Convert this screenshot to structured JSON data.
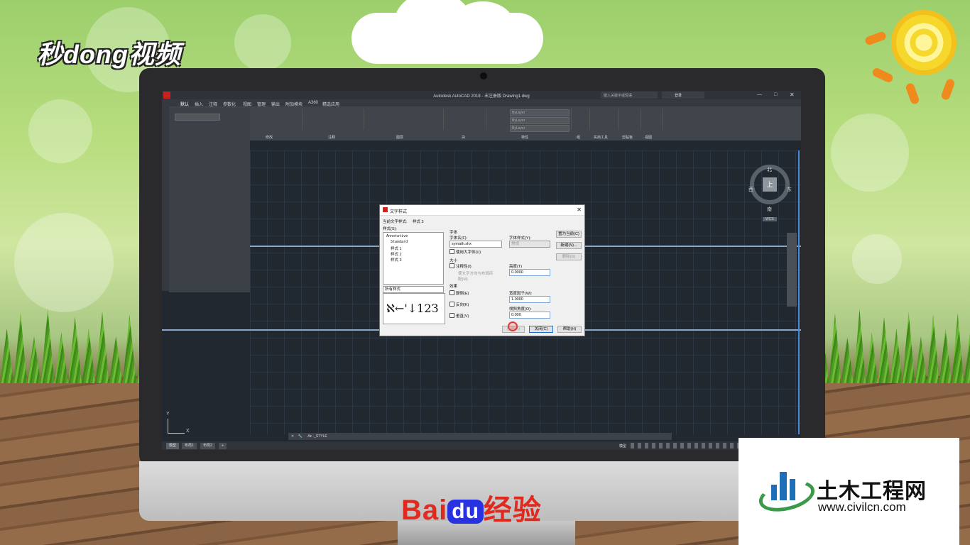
{
  "brand_top_left": "秒dong视频",
  "brand_bottom": {
    "bai": "Bai",
    "du": "du",
    "jingyan": "经验"
  },
  "civil_logo": {
    "name": "土木工程网",
    "url": "www.civilcn.com"
  },
  "autocad": {
    "title": "Autodesk AutoCAD 2018 - 未注册版    Drawing1.dwg",
    "search_placeholder": "键入关键字或短语",
    "login_label": "登录",
    "menu": [
      "默认",
      "插入",
      "注释",
      "参数化",
      "视图",
      "管理",
      "输出",
      "附加模块",
      "A360",
      "精选应用"
    ],
    "ribbon_groups": [
      "修改",
      "注释",
      "图层",
      "块",
      "特性",
      "组",
      "实用工具",
      "剪贴板",
      "视图"
    ],
    "ribbon_bylayer": [
      "ByLayer",
      "ByLayer",
      "ByLayer"
    ],
    "viewcube": {
      "center": "上",
      "north": "北",
      "south": "南",
      "east": "东",
      "west": "西",
      "wcs": "WCS"
    },
    "command_line": "A▾ -_STYLE",
    "layout_tabs": [
      "模型",
      "布局1",
      "布局2",
      "+"
    ],
    "status_model": "模型",
    "ucs": {
      "y": "Y",
      "x": "X"
    }
  },
  "dialog": {
    "title": "文字样式",
    "current_style_label": "当前文字样式:",
    "current_style_value": "样式 3",
    "styles_label": "样式(S):",
    "styles": [
      "Annotative",
      "Standard",
      "样式 1",
      "样式 2",
      "样式 3"
    ],
    "filter_value": "所有样式",
    "font_section": "字体",
    "font_name_label": "字体名(F):",
    "font_name_value": "symath.shx",
    "font_style_label": "字体样式(Y):",
    "font_style_value": "常规",
    "bigfont_label": "使用大字体(U)",
    "size_section": "大小",
    "annotative_label": "注释性(I)",
    "match_orientation_label": "使文字方向与布局匹配(M)",
    "height_label": "高度(T)",
    "height_value": "0.0000",
    "effects_section": "效果",
    "upside_down_label": "颠倒(E)",
    "backwards_label": "反向(K)",
    "vertical_label": "垂直(V)",
    "width_factor_label": "宽度因子(W):",
    "width_factor_value": "1.0000",
    "oblique_label": "倾斜角度(O):",
    "oblique_value": "0.000",
    "preview_text": "ℵ←'↓12З",
    "btn_set_current": "置为当前(C)",
    "btn_new": "新建(N)...",
    "btn_delete": "删除(D)",
    "btn_apply": "应用(A)",
    "btn_close": "关闭(C)",
    "btn_help": "帮助(H)"
  }
}
